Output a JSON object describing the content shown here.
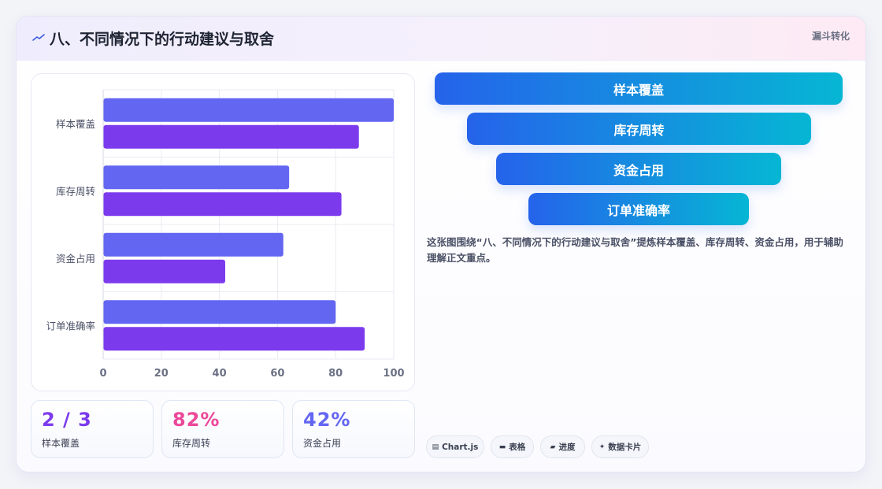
{
  "header": {
    "title": "八、不同情况下的行动建议与取舍",
    "badge": "漏斗转化"
  },
  "chart_data": {
    "type": "bar",
    "orientation": "horizontal",
    "categories": [
      "样本覆盖",
      "库存周转",
      "资金占用",
      "订单准确率"
    ],
    "series": [
      {
        "values": [
          100,
          64,
          62,
          80
        ],
        "color": "#6366f1"
      },
      {
        "values": [
          88,
          82,
          42,
          90
        ],
        "color": "#7c3aed"
      }
    ],
    "xlim": [
      0,
      100
    ],
    "xticks": [
      "0",
      "20",
      "40",
      "60",
      "80",
      "100"
    ],
    "grid": true
  },
  "stats": [
    {
      "value": "2 / 3",
      "label": "样本覆盖",
      "color": "#7c3aed"
    },
    {
      "value": "82%",
      "label": "库存周转",
      "color": "#ec4899"
    },
    {
      "value": "42%",
      "label": "资金占用",
      "color": "#6366f1"
    }
  ],
  "funnel": [
    {
      "label": "样本覆盖"
    },
    {
      "label": "库存周转"
    },
    {
      "label": "资金占用"
    },
    {
      "label": "订单准确率"
    }
  ],
  "description": "这张图围绕“八、不同情况下的行动建议与取舍”提炼样本覆盖、库存周转、资金占用，用于辅助理解正文重点。",
  "tags": [
    {
      "icon": "chart-icon",
      "label": "Chart.js"
    },
    {
      "icon": "table-icon",
      "label": "表格"
    },
    {
      "icon": "progress-icon",
      "label": "进度"
    },
    {
      "icon": "sparkle-icon",
      "label": "数据卡片"
    }
  ]
}
